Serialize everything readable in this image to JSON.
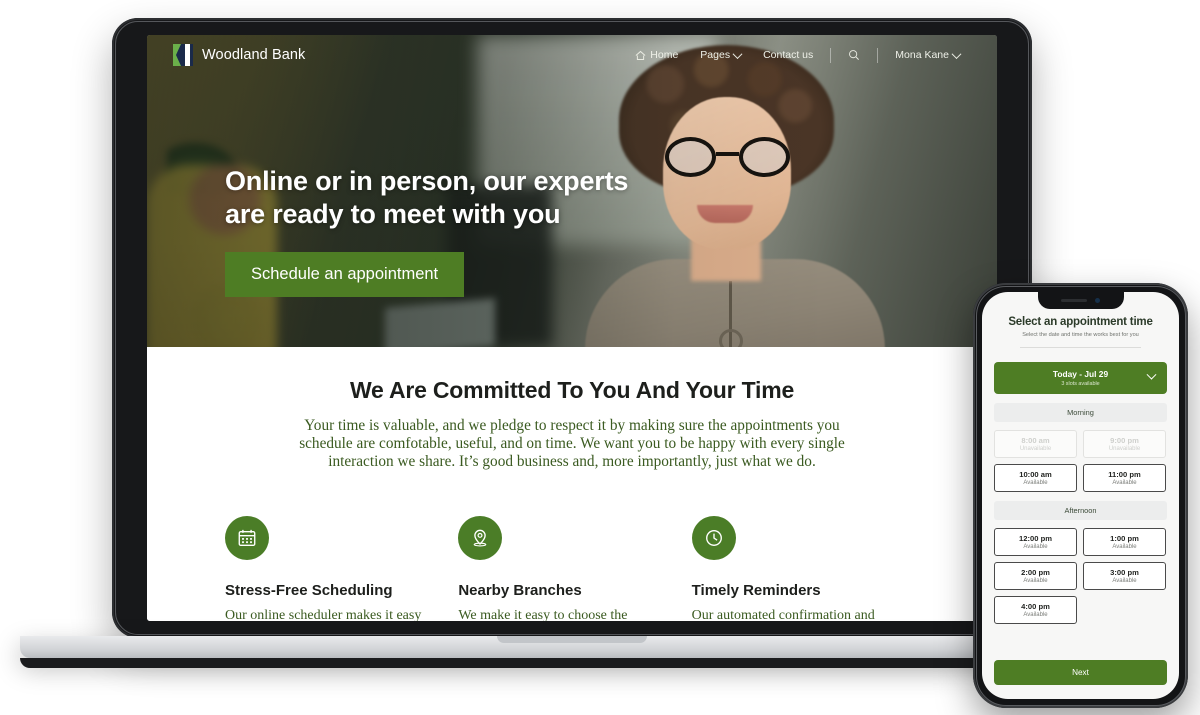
{
  "site": {
    "brand": {
      "name": "Woodland Bank",
      "logo_icon": "woodland-logo-mark"
    },
    "nav": {
      "home": "Home",
      "home_icon": "home-icon",
      "pages": "Pages",
      "pages_chevron_icon": "chevron-down-icon",
      "contact": "Contact us",
      "search_icon": "search-icon",
      "user": "Mona Kane",
      "user_chevron_icon": "chevron-down-icon"
    },
    "hero": {
      "headline_line1": "Online or in person, our experts",
      "headline_line2": "are ready to meet with you",
      "cta": "Schedule an appointment"
    },
    "section": {
      "title": "We Are Committed To You And Your Time",
      "body": "Your time is valuable, and we pledge to respect it by making sure the appointments you schedule are comfotable, useful, and on time. We want you to be happy with every single interaction we share. It’s good business and, more importantly, just what we do."
    },
    "features": [
      {
        "icon": "calendar-icon",
        "title": "Stress-Free Scheduling",
        "body": "Our online scheduler makes it easy to get the meeting time"
      },
      {
        "icon": "map-pin-icon",
        "title": "Nearby Branches",
        "body": "We make it easy to choose the location to meet that is"
      },
      {
        "icon": "clock-icon",
        "title": "Timely Reminders",
        "body": "Our automated confirmation and reminder messages helps"
      }
    ]
  },
  "phone": {
    "title": "Select an appointment time",
    "subtitle": "Select the date and time the works best for you",
    "date_selector": {
      "label": "Today - Jul 29",
      "availability": "3 slots available",
      "chevron_icon": "chevron-down-icon"
    },
    "sections": [
      {
        "label": "Morning",
        "slots": [
          {
            "time": "8:00 am",
            "status": "Unavailable",
            "available": false
          },
          {
            "time": "9:00 pm",
            "status": "Unavailable",
            "available": false
          },
          {
            "time": "10:00 am",
            "status": "Available",
            "available": true
          },
          {
            "time": "11:00 pm",
            "status": "Available",
            "available": true
          }
        ]
      },
      {
        "label": "Afternoon",
        "slots": [
          {
            "time": "12:00 pm",
            "status": "Available",
            "available": true
          },
          {
            "time": "1:00 pm",
            "status": "Available",
            "available": true
          },
          {
            "time": "2:00 pm",
            "status": "Available",
            "available": true
          },
          {
            "time": "3:00 pm",
            "status": "Available",
            "available": true
          },
          {
            "time": "4:00 pm",
            "status": "Available",
            "available": true
          }
        ]
      }
    ],
    "next_button": "Next"
  },
  "colors": {
    "brand_green": "#4e7d24",
    "body_green": "#3a5a20",
    "heading_dark": "#1d1f1c"
  }
}
